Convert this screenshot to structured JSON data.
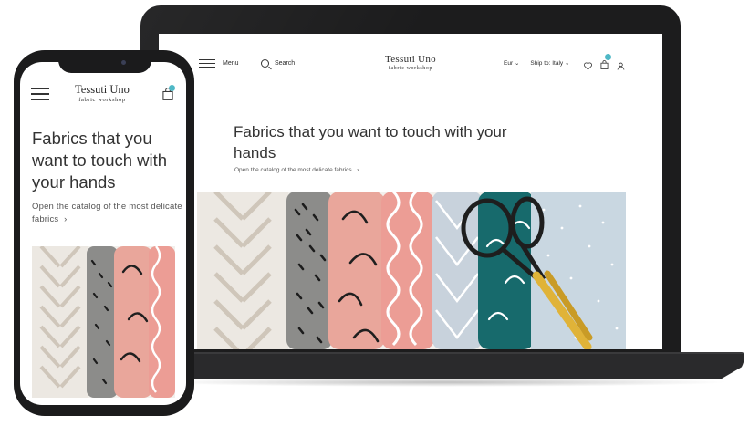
{
  "site": {
    "brand_name": "Tessuti Uno",
    "brand_tagline": "fabric workshop",
    "accent_color": "#4fb8c6"
  },
  "laptop": {
    "menu_label": "Menu",
    "search_label": "Search",
    "currency": "Eur",
    "ship_to": "Ship to: Italy",
    "cart_count": "",
    "hero_title": "Fabrics that you want to touch with your hands",
    "hero_link": "Open the catalog of the most delicate fabrics"
  },
  "phone": {
    "cart_count": "",
    "hero_title": "Fabrics that you want to touch with your hands",
    "hero_link": "Open the catalog of the most delicate fabrics"
  },
  "fabrics": [
    {
      "name": "herringbone",
      "color": "#ede9e3",
      "pattern": "#c6bdb2"
    },
    {
      "name": "dashes",
      "color": "#8c8c8a",
      "pattern": "#1c1c1c"
    },
    {
      "name": "arches",
      "color": "#e9a69b",
      "pattern": "#1f1f1f"
    },
    {
      "name": "waves",
      "color": "#ec9d95",
      "pattern": "#ffffff"
    },
    {
      "name": "diamonds",
      "color": "#c8d2dc",
      "pattern": "#ffffff"
    },
    {
      "name": "teal-arches",
      "color": "#176a6c",
      "pattern": "#ffffff"
    },
    {
      "name": "dots",
      "color": "#c9d7e1",
      "pattern": "#ffffff"
    }
  ]
}
